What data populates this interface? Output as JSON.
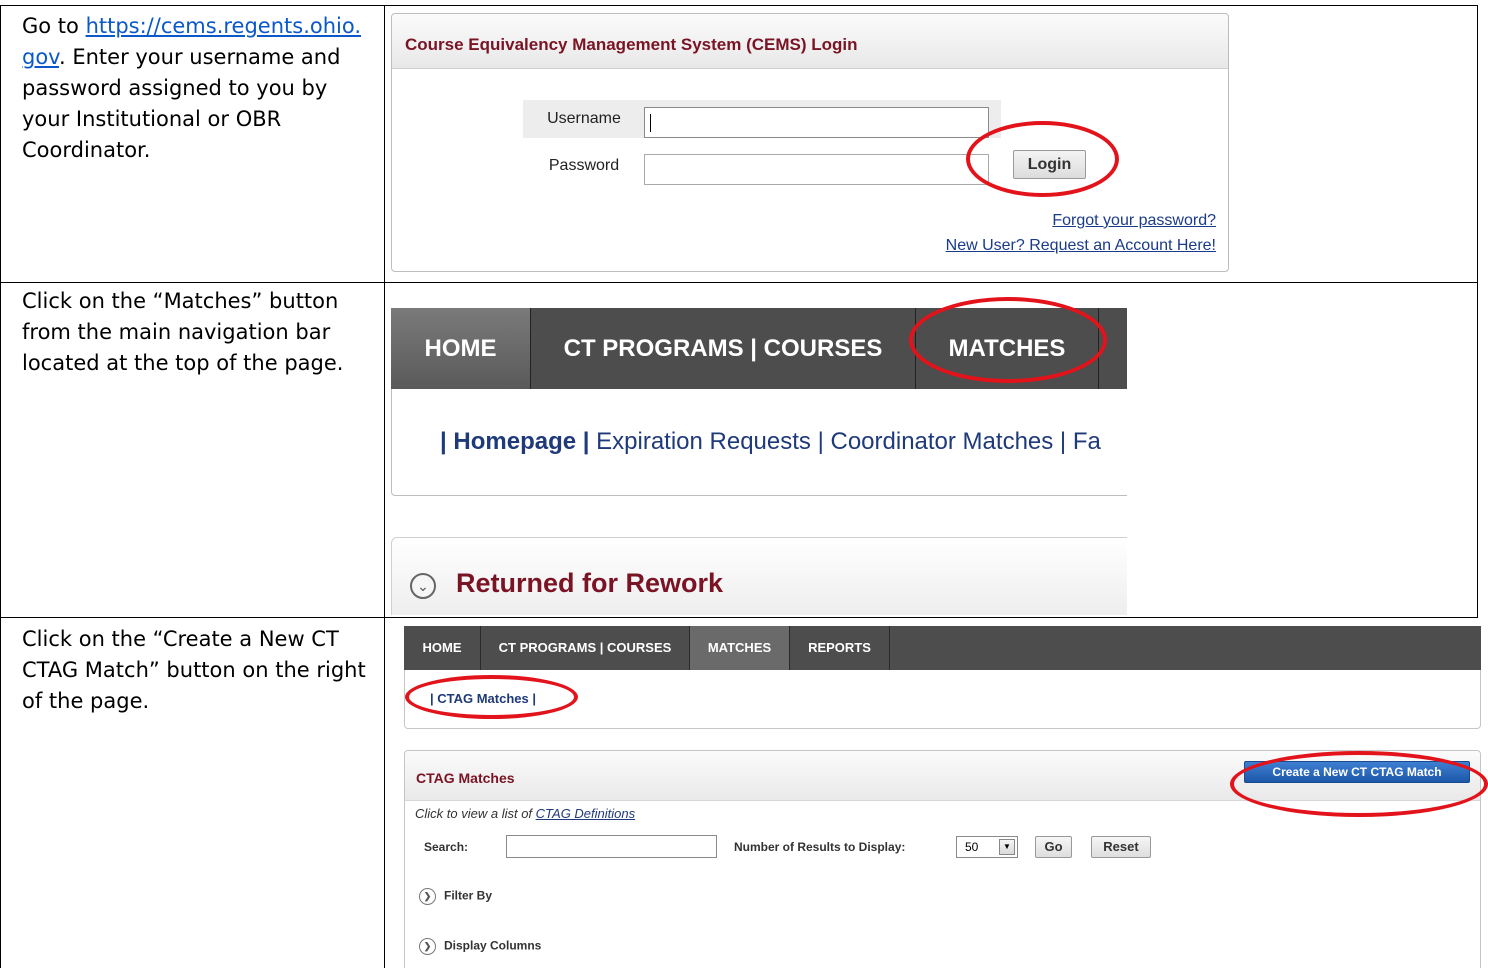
{
  "instructions": [
    {
      "before_link": "Go to ",
      "link": "https://cems.regents.ohio.gov",
      "after_link": ". Enter your username and password assigned to you by your Institutional or OBR Coordinator."
    },
    {
      "text": "Click on the “Matches” button from the main navigation bar located at the top of the page."
    },
    {
      "text": "Click on the “Create a New CT CTAG Match” button on the right of the page."
    }
  ],
  "login": {
    "title": "Course Equivalency Management System (CEMS) Login",
    "username_label": "Username",
    "password_label": "Password",
    "login_button": "Login",
    "forgot_link": "Forgot your password?",
    "new_user_link": "New User? Request an Account Here!"
  },
  "nav_large": {
    "home": "HOME",
    "ct_programs": "CT PROGRAMS | COURSES",
    "matches": "MATCHES",
    "sub_homepage": "| Homepage |",
    "sub_items": " Expiration Requests |  Coordinator Matches |  Fa",
    "section_title": "Returned for Rework"
  },
  "nav_small": {
    "home": "HOME",
    "ct_programs": "CT PROGRAMS | COURSES",
    "matches": "MATCHES",
    "reports": "REPORTS",
    "sub_link": "| CTAG Matches |"
  },
  "ctag": {
    "title": "CTAG Matches",
    "create_button": "Create a New CT CTAG Match",
    "hint_prefix": "Click to view a list of ",
    "hint_link": "CTAG Definitions",
    "search_label": "Search:",
    "results_label": "Number of Results to Display:",
    "results_value": "50",
    "go_button": "Go",
    "reset_button": "Reset",
    "filter_by": "Filter By",
    "display_columns": "Display Columns"
  },
  "colors": {
    "highlight_ring": "#e2131b",
    "maroon_title": "#7a1424",
    "link_blue": "#1f3a7a",
    "nav_dark": "#4d4d4d",
    "button_blue": "#1d57a8"
  }
}
